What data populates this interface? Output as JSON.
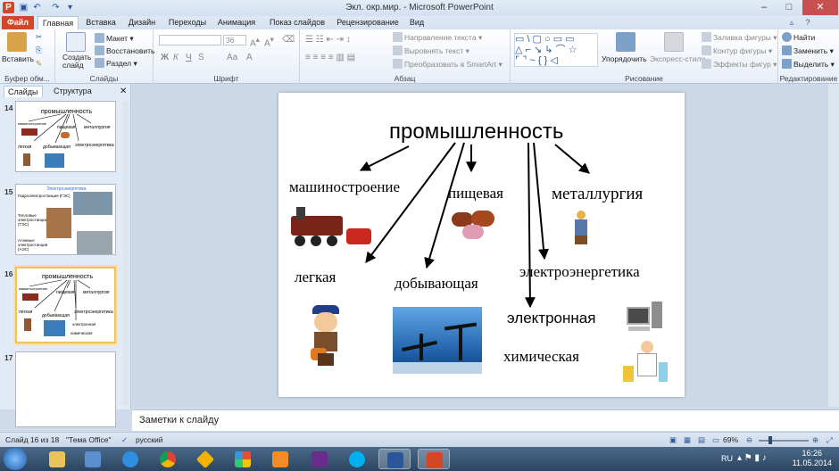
{
  "window": {
    "title": "Экл. окр.мир. - Microsoft PowerPoint",
    "buttons": {
      "minimize": "–",
      "maximize": "□",
      "close": "✕"
    }
  },
  "tabs": [
    "Файл",
    "Главная",
    "Вставка",
    "Дизайн",
    "Переходы",
    "Анимация",
    "Показ слайдов",
    "Рецензирование",
    "Вид"
  ],
  "ribbon": {
    "clipboard": {
      "paste": "Вставить",
      "label": "Буфер обм..."
    },
    "slides": {
      "new_slide": "Создать слайд",
      "layout": "Макет",
      "reset": "Восстановить",
      "section": "Раздел",
      "label": "Слайды"
    },
    "font": {
      "size": "36",
      "label": "Шрифт",
      "bold": "Ж",
      "italic": "К",
      "underline": "Ч",
      "strike": "S",
      "case": "Aa"
    },
    "paragraph": {
      "text_direction": "Направление текста",
      "align_text": "Выровнять текст",
      "smartart": "Преобразовать в SmartArt",
      "label": "Абзац"
    },
    "drawing": {
      "arrange": "Упорядочить",
      "quick_styles": "Экспресс-стили",
      "fill": "Заливка фигуры",
      "outline": "Контур фигуры",
      "effects": "Эффекты фигур",
      "label": "Рисование"
    },
    "editing": {
      "find": "Найти",
      "replace": "Заменить",
      "select": "Выделить",
      "label": "Редактирование"
    }
  },
  "leftpane": {
    "tab_slides": "Слайды",
    "tab_outline": "Структура",
    "thumbs": [
      {
        "num": "14",
        "title": "промышленность",
        "items": [
          "машиностроение",
          "пищевая",
          "металлургия",
          "легкая",
          "добывающая",
          "электроэнергетика"
        ]
      },
      {
        "num": "15",
        "title": "Электроэнергетика",
        "items": [
          "Гидроэлектростанция (ГЭС)",
          "Тепловые электростанции (ТЭС)",
          "Атомные электростанции (АЭС)"
        ]
      },
      {
        "num": "16",
        "title": "промышленность",
        "items": [
          "машиностроение",
          "пищевая",
          "металлургия",
          "легкая",
          "добывающая",
          "электроэнергетика",
          "электронная",
          "химическая"
        ]
      },
      {
        "num": "17"
      }
    ]
  },
  "slide": {
    "title": "промышленность",
    "branches": [
      "машиностроение",
      "пищевая",
      "металлургия",
      "легкая",
      "добывающая",
      "электроэнергетика",
      "электронная",
      "химическая"
    ]
  },
  "notes": {
    "placeholder": "Заметки к слайду"
  },
  "status": {
    "slide_info": "Слайд 16 из 18",
    "theme": "\"Тема Office\"",
    "language": "русский",
    "zoom": "69%"
  },
  "taskbar": {
    "lang": "RU",
    "time": "16:26",
    "date": "11.05.2014"
  }
}
